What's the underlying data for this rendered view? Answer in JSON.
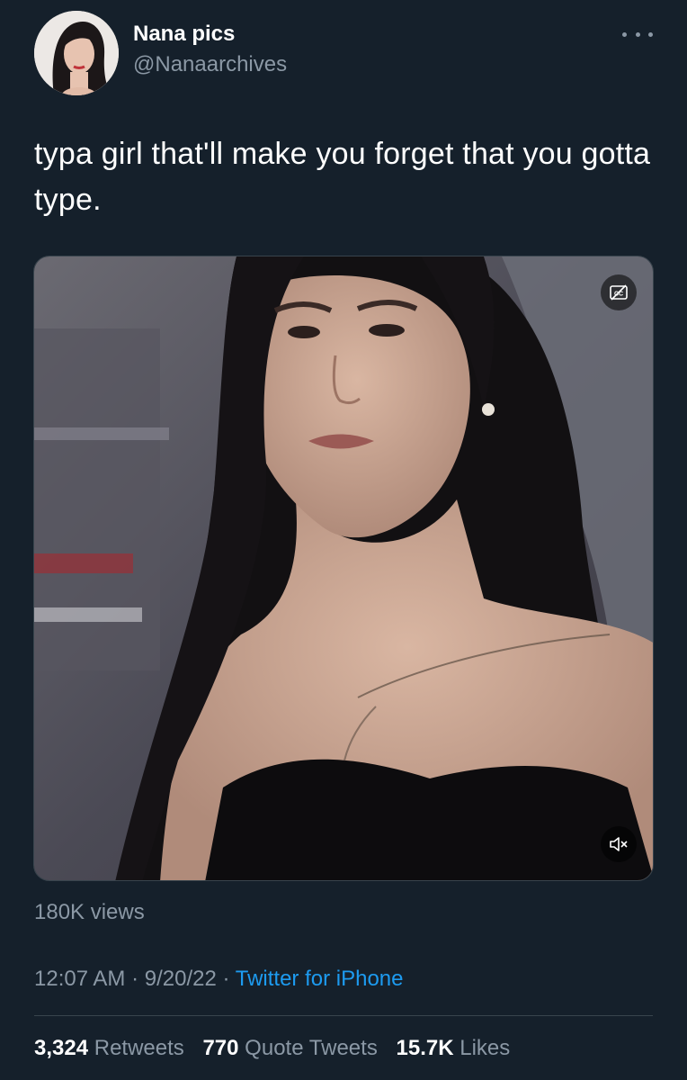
{
  "author": {
    "name": "Nana pics",
    "handle": "@Nanaarchives"
  },
  "tweet": {
    "text": "typa girl that'll make you forget that you gotta type."
  },
  "media": {
    "icons": [
      "closed-captions-icon",
      "muted-speaker-icon"
    ]
  },
  "views_text": "180K views",
  "meta": {
    "time": "12:07 AM",
    "separator": "·",
    "date": "9/20/22",
    "source": "Twitter for iPhone"
  },
  "stats": {
    "retweets_count": "3,324",
    "retweets_label": "Retweets",
    "quotes_count": "770",
    "quotes_label": "Quote Tweets",
    "likes_count": "15.7K",
    "likes_label": "Likes"
  },
  "colors": {
    "background": "#15202b",
    "text_primary": "#ffffff",
    "text_secondary": "#8b98a5",
    "link": "#1d9bf0",
    "divider": "#38444d"
  }
}
